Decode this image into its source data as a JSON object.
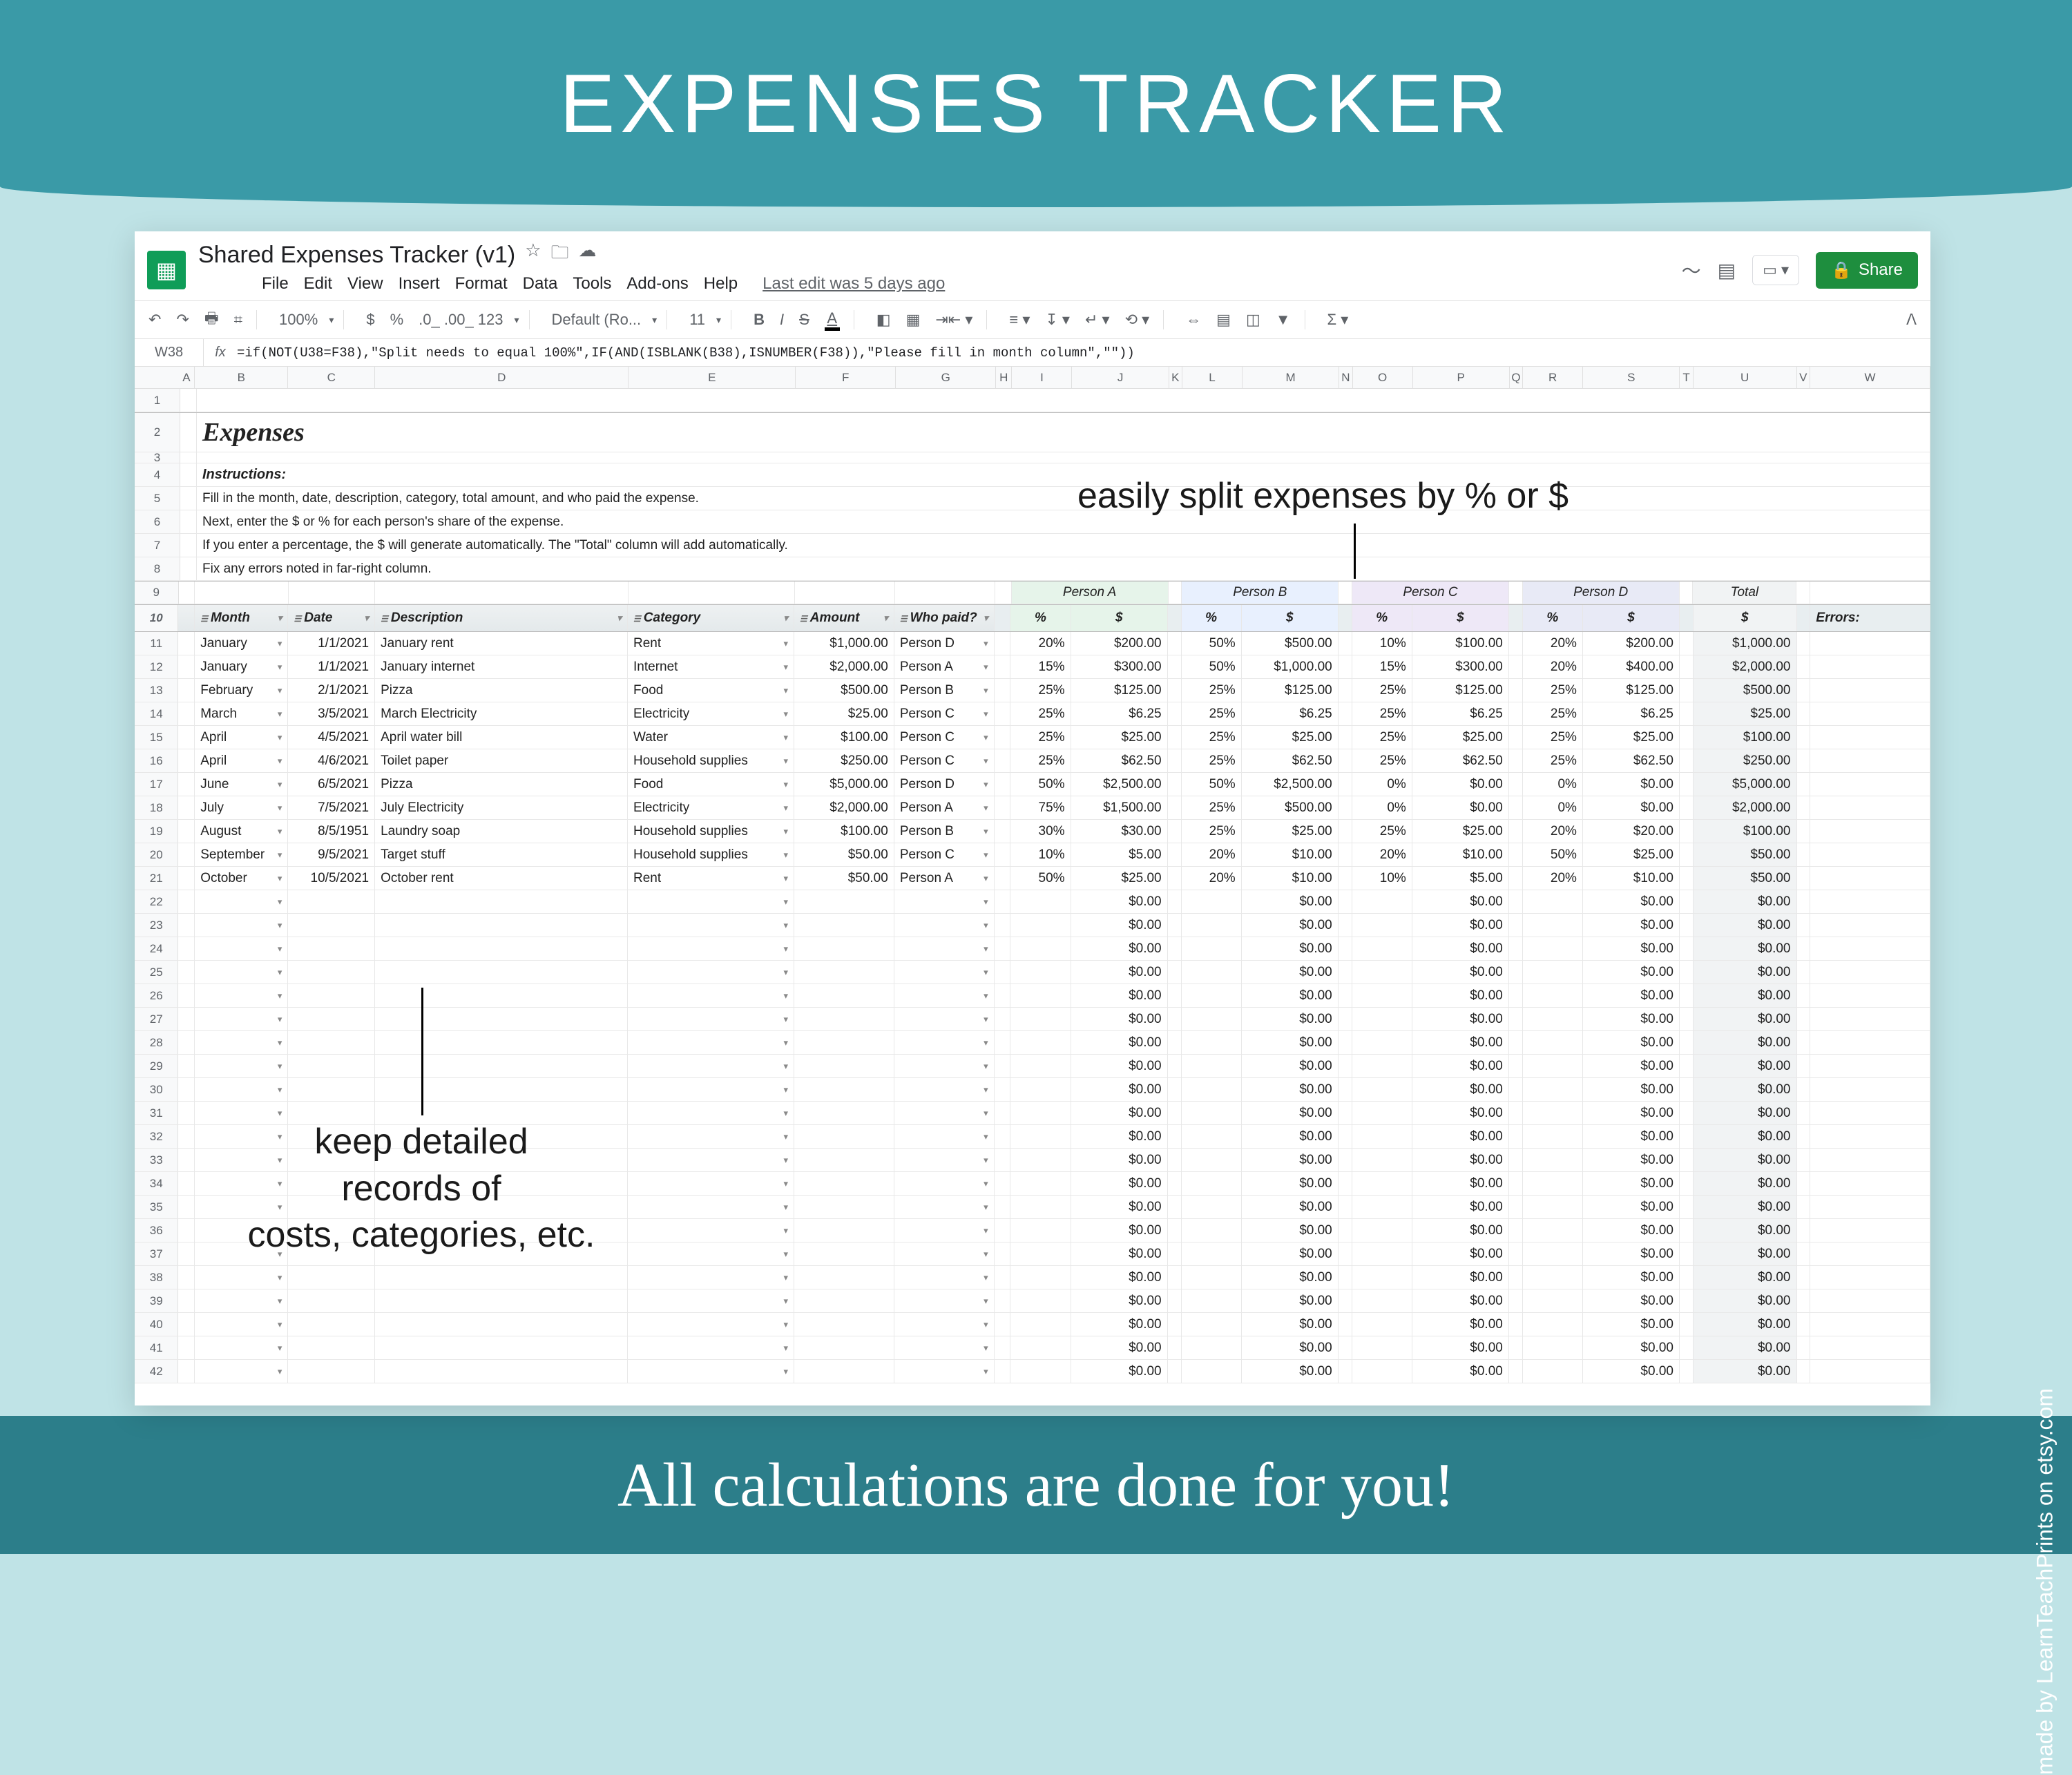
{
  "banner": {
    "top": "EXPENSES TRACKER",
    "bottom": "All calculations are done for you!",
    "credit": "made by LearnTeachPrints on etsy.com"
  },
  "annotations": {
    "top": "easily split expenses by % or $",
    "bottom": "keep detailed\nrecords of\ncosts, categories, etc."
  },
  "doc": {
    "title": "Shared Expenses Tracker (v1)",
    "menu": [
      "File",
      "Edit",
      "View",
      "Insert",
      "Format",
      "Data",
      "Tools",
      "Add-ons",
      "Help"
    ],
    "last_edit": "Last edit was 5 days ago",
    "share": "Share",
    "name_box": "W38",
    "formula": "=if(NOT(U38=F38),\"Split needs to equal 100%\",IF(AND(ISBLANK(B38),ISNUMBER(F38)),\"Please fill in month column\",\"\"))",
    "toolbar": {
      "zoom": "100%",
      "font": "Default (Ro...",
      "size": "11",
      "fmt": ".0_ .00_ 123"
    }
  },
  "section_title": "Expenses",
  "instruction_label": "Instructions:",
  "instructions": [
    "Fill in the month, date, description, category, total amount, and who paid the expense.",
    "Next, enter the $ or % for each person's share of the expense.",
    "If you enter a percentage, the $ will generate automatically. The \"Total\" column will add automatically.",
    "Fix any errors noted in far-right column."
  ],
  "col_letters": [
    "A",
    "B",
    "C",
    "D",
    "E",
    "F",
    "G",
    "H",
    "I",
    "J",
    "K",
    "L",
    "M",
    "N",
    "O",
    "P",
    "Q",
    "R",
    "S",
    "T",
    "U",
    "V",
    "W"
  ],
  "people": [
    "Person A",
    "Person B",
    "Person C",
    "Person D"
  ],
  "total_label": "Total",
  "errors_label": "Errors:",
  "headers": {
    "month": "Month",
    "date": "Date",
    "desc": "Description",
    "cat": "Category",
    "amt": "Amount",
    "who": "Who paid?",
    "pct": "%",
    "dol": "$"
  },
  "rows": [
    {
      "month": "January",
      "date": "1/1/2021",
      "desc": "January rent",
      "cat": "Rent",
      "amt": "$1,000.00",
      "who": "Person D",
      "pA": "20%",
      "dA": "$200.00",
      "pB": "50%",
      "dB": "$500.00",
      "pC": "10%",
      "dC": "$100.00",
      "pD": "20%",
      "dD": "$200.00",
      "tot": "$1,000.00"
    },
    {
      "month": "January",
      "date": "1/1/2021",
      "desc": "January internet",
      "cat": "Internet",
      "amt": "$2,000.00",
      "who": "Person A",
      "pA": "15%",
      "dA": "$300.00",
      "pB": "50%",
      "dB": "$1,000.00",
      "pC": "15%",
      "dC": "$300.00",
      "pD": "20%",
      "dD": "$400.00",
      "tot": "$2,000.00"
    },
    {
      "month": "February",
      "date": "2/1/2021",
      "desc": "Pizza",
      "cat": "Food",
      "amt": "$500.00",
      "who": "Person B",
      "pA": "25%",
      "dA": "$125.00",
      "pB": "25%",
      "dB": "$125.00",
      "pC": "25%",
      "dC": "$125.00",
      "pD": "25%",
      "dD": "$125.00",
      "tot": "$500.00"
    },
    {
      "month": "March",
      "date": "3/5/2021",
      "desc": "March Electricity",
      "cat": "Electricity",
      "amt": "$25.00",
      "who": "Person C",
      "pA": "25%",
      "dA": "$6.25",
      "pB": "25%",
      "dB": "$6.25",
      "pC": "25%",
      "dC": "$6.25",
      "pD": "25%",
      "dD": "$6.25",
      "tot": "$25.00"
    },
    {
      "month": "April",
      "date": "4/5/2021",
      "desc": "April water bill",
      "cat": "Water",
      "amt": "$100.00",
      "who": "Person C",
      "pA": "25%",
      "dA": "$25.00",
      "pB": "25%",
      "dB": "$25.00",
      "pC": "25%",
      "dC": "$25.00",
      "pD": "25%",
      "dD": "$25.00",
      "tot": "$100.00"
    },
    {
      "month": "April",
      "date": "4/6/2021",
      "desc": "Toilet paper",
      "cat": "Household supplies",
      "amt": "$250.00",
      "who": "Person C",
      "pA": "25%",
      "dA": "$62.50",
      "pB": "25%",
      "dB": "$62.50",
      "pC": "25%",
      "dC": "$62.50",
      "pD": "25%",
      "dD": "$62.50",
      "tot": "$250.00"
    },
    {
      "month": "June",
      "date": "6/5/2021",
      "desc": "Pizza",
      "cat": "Food",
      "amt": "$5,000.00",
      "who": "Person D",
      "pA": "50%",
      "dA": "$2,500.00",
      "pB": "50%",
      "dB": "$2,500.00",
      "pC": "0%",
      "dC": "$0.00",
      "pD": "0%",
      "dD": "$0.00",
      "tot": "$5,000.00"
    },
    {
      "month": "July",
      "date": "7/5/2021",
      "desc": "July Electricity",
      "cat": "Electricity",
      "amt": "$2,000.00",
      "who": "Person A",
      "pA": "75%",
      "dA": "$1,500.00",
      "pB": "25%",
      "dB": "$500.00",
      "pC": "0%",
      "dC": "$0.00",
      "pD": "0%",
      "dD": "$0.00",
      "tot": "$2,000.00"
    },
    {
      "month": "August",
      "date": "8/5/1951",
      "desc": "Laundry soap",
      "cat": "Household supplies",
      "amt": "$100.00",
      "who": "Person B",
      "pA": "30%",
      "dA": "$30.00",
      "pB": "25%",
      "dB": "$25.00",
      "pC": "25%",
      "dC": "$25.00",
      "pD": "20%",
      "dD": "$20.00",
      "tot": "$100.00"
    },
    {
      "month": "September",
      "date": "9/5/2021",
      "desc": "Target stuff",
      "cat": "Household supplies",
      "amt": "$50.00",
      "who": "Person C",
      "pA": "10%",
      "dA": "$5.00",
      "pB": "20%",
      "dB": "$10.00",
      "pC": "20%",
      "dC": "$10.00",
      "pD": "50%",
      "dD": "$25.00",
      "tot": "$50.00"
    },
    {
      "month": "October",
      "date": "10/5/2021",
      "desc": "October rent",
      "cat": "Rent",
      "amt": "$50.00",
      "who": "Person A",
      "pA": "50%",
      "dA": "$25.00",
      "pB": "20%",
      "dB": "$10.00",
      "pC": "10%",
      "dC": "$5.00",
      "pD": "20%",
      "dD": "$10.00",
      "tot": "$50.00"
    }
  ],
  "empty_row": {
    "dA": "$0.00",
    "dB": "$0.00",
    "dC": "$0.00",
    "dD": "$0.00",
    "tot": "$0.00"
  },
  "empty_count": 21
}
